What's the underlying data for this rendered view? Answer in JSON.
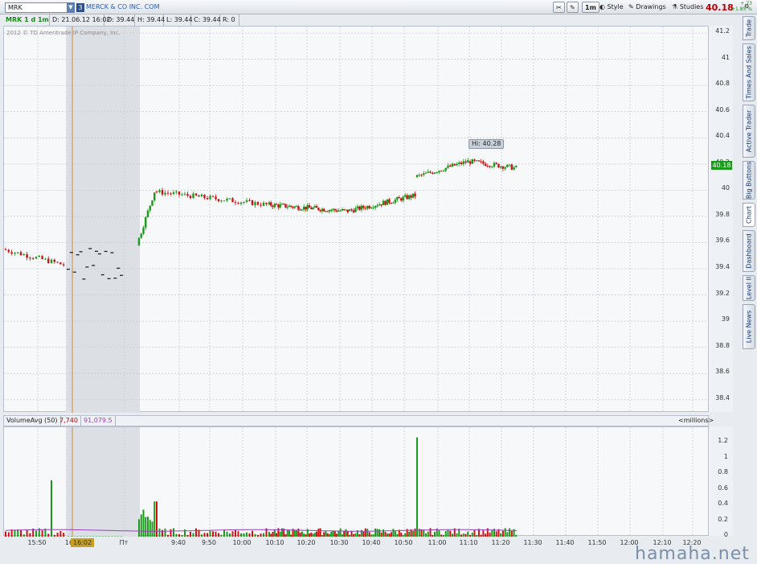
{
  "toolbar": {
    "symbol": "MRK",
    "symbol_num": "3",
    "company": "MERCK & CO INC. COM",
    "interval": "1m",
    "style_label": "Style",
    "drawings_label": "Drawings",
    "studies_label": "Studies",
    "last_price": "40.18",
    "change_abs": "+.73",
    "change_pct": "+1.85 %"
  },
  "infobar": {
    "title": "MRK 1 d 1m",
    "date": "D: 21.06.12 16:02",
    "open": "O: 39.44",
    "high": "H: 39.44",
    "low": "L: 39.44",
    "close": "C: 39.44",
    "range": "R: 0"
  },
  "chart": {
    "copyright": "2012 © TD Ameritrade IP Company, Inc.",
    "hi_label": "Hi: 40.28",
    "last_tag": "40.18",
    "price_ticks": [
      "41.2",
      "41",
      "40.8",
      "40.6",
      "40.4",
      "40.2",
      "40",
      "39.8",
      "39.6",
      "39.4",
      "39.2",
      "39",
      "38.8",
      "38.6",
      "38.4"
    ]
  },
  "volume": {
    "study": "VolumeAvg (50)",
    "value1": "7,740",
    "value2": "91,079.5",
    "units": "<millions>",
    "ticks": [
      "1.2",
      "1",
      "0.8",
      "0.6",
      "0.4",
      "0.2",
      "0"
    ]
  },
  "time_axis": {
    "ticks": [
      "15:50",
      "16",
      "Пт",
      "9:40",
      "9:50",
      "10:00",
      "10:10",
      "10:20",
      "10:30",
      "10:40",
      "10:50",
      "11:00",
      "11:10",
      "11:20",
      "11:30",
      "11:40",
      "11:50",
      "12:00",
      "12:10",
      "12:20"
    ],
    "cursor_label": "16:02"
  },
  "right_tabs": [
    "Trade",
    "Times And Sales",
    "Active Trader",
    "Big Buttons",
    "Chart",
    "Dashboard",
    "Level II",
    "Live News"
  ],
  "watermark": "hamaha.net",
  "colors": {
    "up": "#1a9a1a",
    "down": "#d01010",
    "avg_line": "#9a40c0"
  },
  "chart_data": {
    "type": "candlestick",
    "ylim": [
      38.3,
      41.25
    ],
    "vol_ylim": [
      0,
      1.4
    ],
    "hi": 40.28,
    "last": 40.18,
    "segments": [
      {
        "from": 39.55,
        "to": 39.43,
        "n": 20,
        "session": "pre"
      },
      {
        "from": 39.44,
        "to": 39.44,
        "n": 18,
        "session": "after"
      },
      {
        "from": 39.58,
        "to": 39.99,
        "n": 8,
        "session": "open"
      },
      {
        "from": 39.99,
        "to": 39.89,
        "n": 40,
        "session": "reg"
      },
      {
        "from": 39.89,
        "to": 39.84,
        "n": 44,
        "session": "reg"
      },
      {
        "from": 39.84,
        "to": 39.96,
        "n": 34,
        "session": "reg"
      },
      {
        "from": 40.1,
        "to": 40.22,
        "n": 24,
        "session": "reg"
      },
      {
        "from": 40.22,
        "to": 40.17,
        "n": 22,
        "session": "reg"
      }
    ]
  }
}
